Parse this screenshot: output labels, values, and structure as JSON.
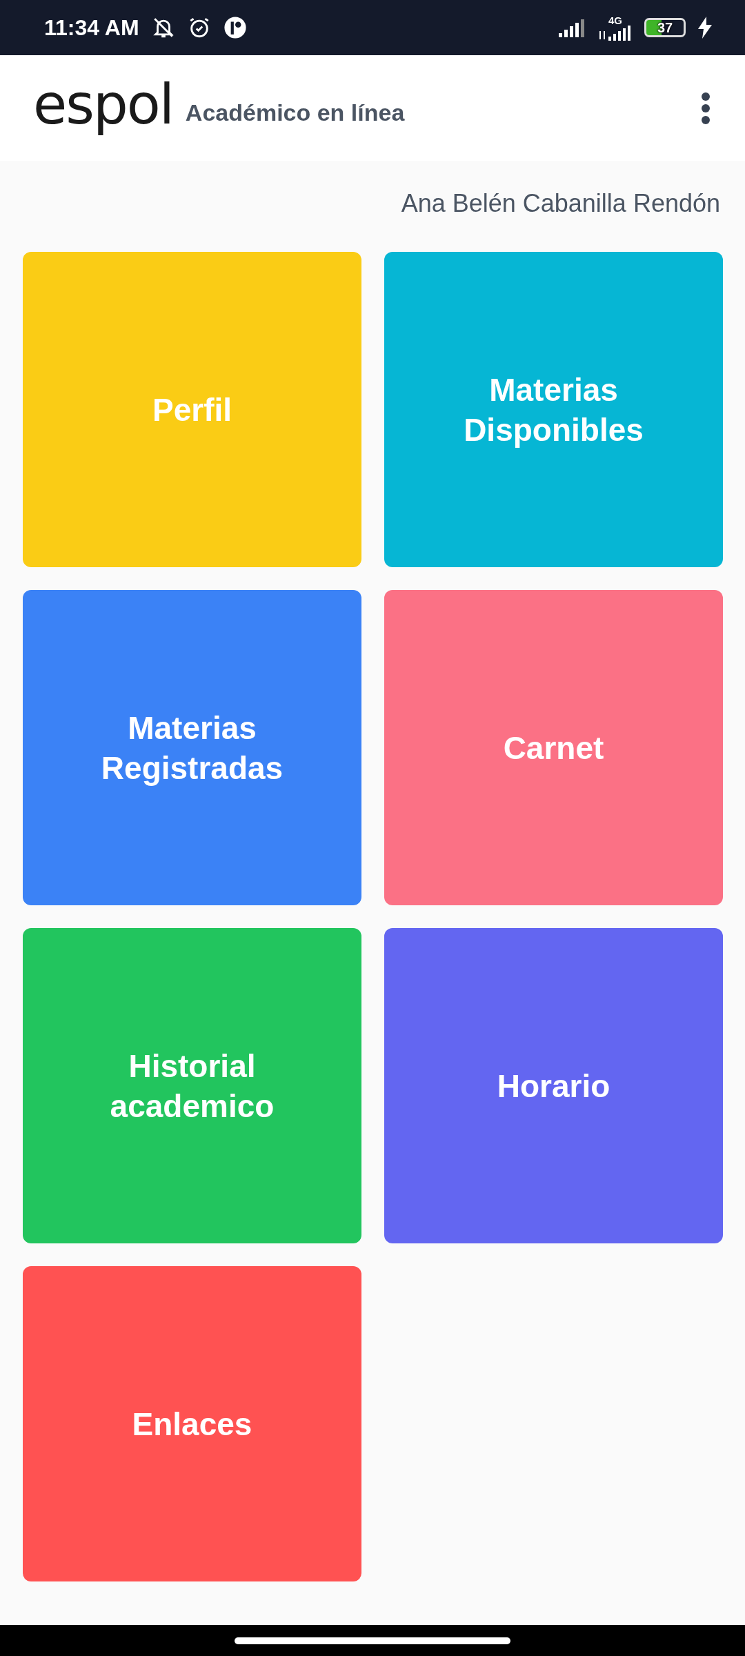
{
  "status_bar": {
    "time": "11:34 AM",
    "network": "4G",
    "battery": "37"
  },
  "header": {
    "logo": "espol",
    "title": "Académico en línea"
  },
  "user_name": "Ana Belén Cabanilla Rendón",
  "tiles": [
    {
      "label": "Perfil",
      "color": "#facc15"
    },
    {
      "label": "Materias Disponibles",
      "color": "#06b6d4"
    },
    {
      "label": "Materias Registradas",
      "color": "#3b82f6"
    },
    {
      "label": "Carnet",
      "color": "#fb7185"
    },
    {
      "label": "Historial academico",
      "color": "#22c55e"
    },
    {
      "label": "Horario",
      "color": "#6366f1"
    },
    {
      "label": "Enlaces",
      "color": "#ff5252"
    }
  ]
}
